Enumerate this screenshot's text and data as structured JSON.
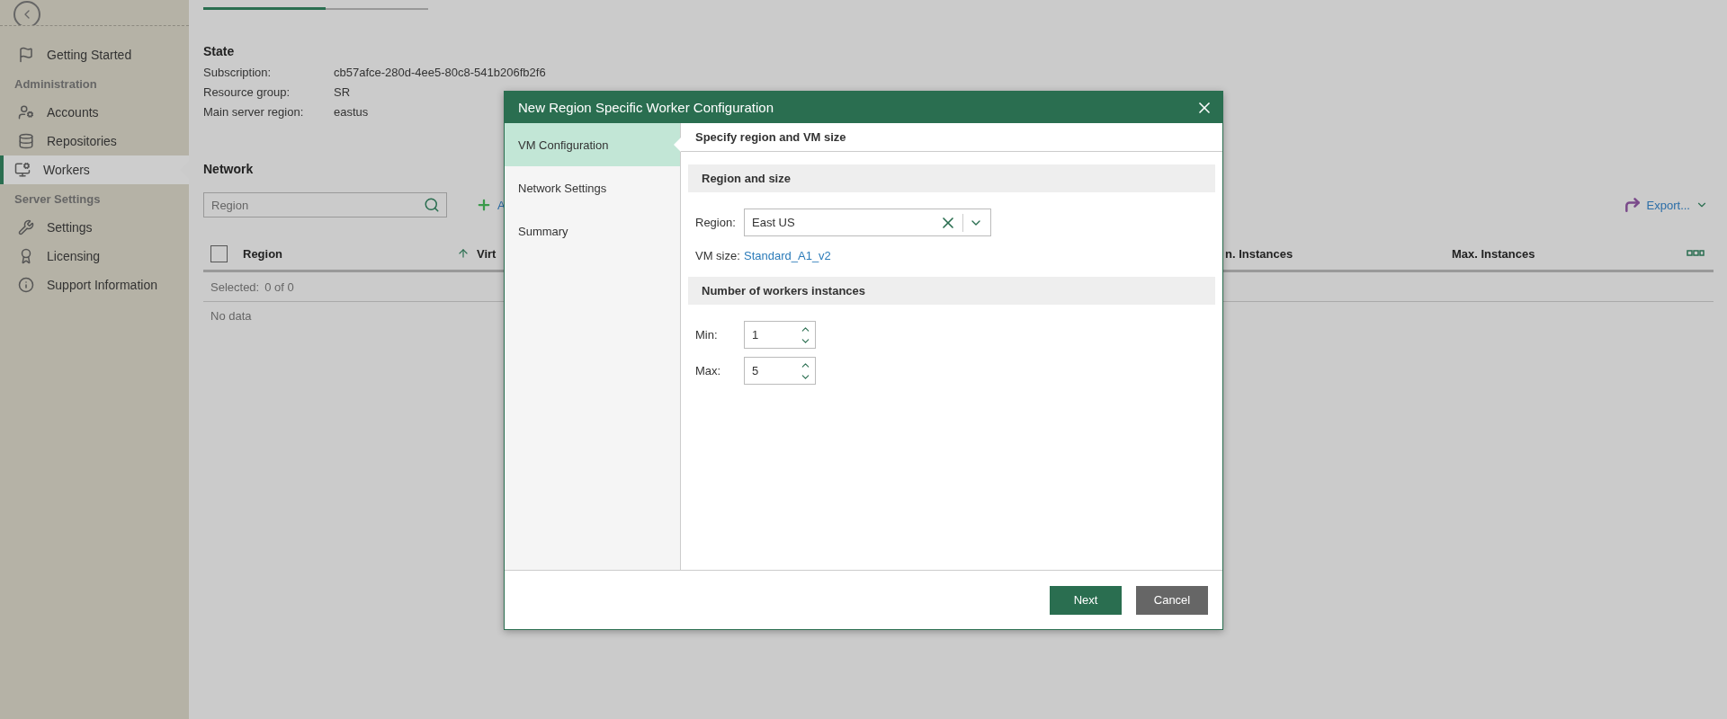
{
  "sidebar": {
    "items": [
      {
        "kind": "item",
        "label": "Getting Started",
        "selected": false
      },
      {
        "kind": "header",
        "label": "Administration"
      },
      {
        "kind": "item",
        "label": "Accounts",
        "selected": false
      },
      {
        "kind": "item",
        "label": "Repositories",
        "selected": false
      },
      {
        "kind": "item",
        "label": "Workers",
        "selected": true
      },
      {
        "kind": "header",
        "label": "Server Settings"
      },
      {
        "kind": "item",
        "label": "Settings",
        "selected": false
      },
      {
        "kind": "item",
        "label": "Licensing",
        "selected": false
      },
      {
        "kind": "item",
        "label": "Support Information",
        "selected": false
      }
    ]
  },
  "tabs": [
    {
      "selected": true
    },
    {
      "selected": false
    }
  ],
  "state": {
    "title": "State",
    "fields": [
      {
        "label": "Subscription:",
        "value": "cb57afce-280d-4ee5-80c8-541b206fb2f6"
      },
      {
        "label": "Resource group:",
        "value": "SR"
      },
      {
        "label": "Main server region:",
        "value": "eastus"
      }
    ]
  },
  "network": {
    "title": "Network",
    "search": {
      "placeholder": "Region"
    },
    "add_label": "A",
    "export_label": "Export...",
    "columns": [
      {
        "label": "Region",
        "sorted": true
      },
      {
        "label": "Virt",
        "sorted": false
      },
      {
        "label": "n. Instances",
        "sorted": false
      },
      {
        "label": "Max. Instances",
        "sorted": false
      }
    ],
    "select_all": {
      "checked": false
    },
    "selected_label": "Selected:",
    "selected_value": "0 of 0",
    "empty": "No data"
  },
  "dialog": {
    "title": "New Region Specific Worker Configuration",
    "steps": [
      {
        "label": "VM Configuration",
        "selected": true
      },
      {
        "label": "Network Settings",
        "selected": false
      },
      {
        "label": "Summary",
        "selected": false
      }
    ],
    "header": "Specify region and VM size",
    "sections": [
      {
        "title": "Region and size",
        "fields": [
          {
            "kind": "combo",
            "label": "Region:",
            "value": "East US"
          },
          {
            "kind": "link",
            "label": "VM size:",
            "value": "Standard_A1_v2"
          }
        ]
      },
      {
        "title": "Number of workers instances",
        "fields": [
          {
            "kind": "spinner",
            "label": "Min:",
            "value": "1"
          },
          {
            "kind": "spinner",
            "label": "Max:",
            "value": "5"
          }
        ]
      }
    ],
    "buttons": [
      {
        "label": "Next",
        "kind": "primary"
      },
      {
        "label": "Cancel",
        "kind": "secondary"
      }
    ]
  }
}
